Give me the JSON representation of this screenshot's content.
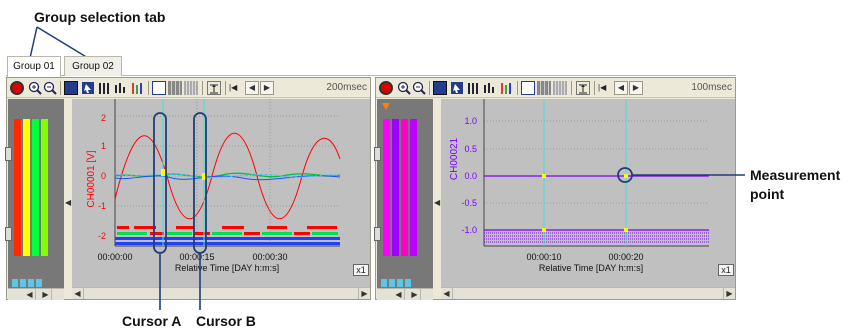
{
  "annotations": {
    "group_tab": "Group selection tab",
    "cursor_a": "Cursor A",
    "cursor_b": "Cursor B",
    "measurement_point_line1": "Measurement",
    "measurement_point_line2": "point"
  },
  "tabs": [
    {
      "label": "Group 01",
      "active": true
    },
    {
      "label": "Group 02",
      "active": false
    }
  ],
  "panels": [
    {
      "rate": "200msec",
      "ylabel": "CH00001 [V]",
      "yticks": [
        "2",
        "1",
        "0",
        "-1",
        "-2"
      ],
      "xticks": [
        "00:00:00",
        "00:00:15",
        "00:00:30"
      ],
      "xlabel": "Relative Time [DAY h:m:s]",
      "scale_button": "x1",
      "meter_colors": [
        "#ff2a00",
        "#ffff00",
        "#00ff3a",
        "#7fff00"
      ]
    },
    {
      "rate": "100msec",
      "ylabel": "CH00021",
      "yticks": [
        "1.0",
        "0.5",
        "0.0",
        "-0.5",
        "-1.0"
      ],
      "xticks": [
        "00:00:10",
        "00:00:20"
      ],
      "xlabel": "Relative Time [DAY h:m:s]",
      "scale_button": "x1",
      "meter_colors": [
        "#ff00ff",
        "#a000ff",
        "#ff00c8",
        "#c000ff"
      ]
    }
  ],
  "colors": {
    "plot_bg": "#c0c0c0",
    "cursor": "#40e0e0",
    "callout_outline": "#1f3e7a",
    "signal_red": "#ff0000",
    "signal_purple": "#8000ff"
  }
}
